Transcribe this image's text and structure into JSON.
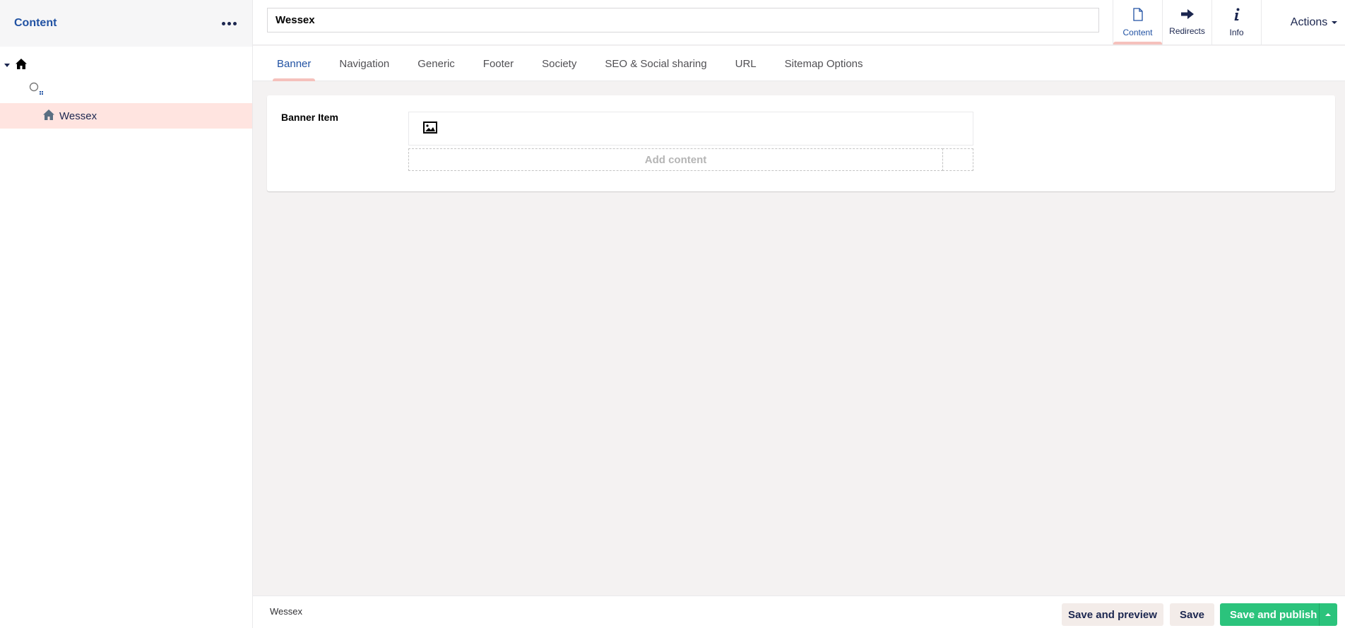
{
  "sidebar": {
    "title": "Content",
    "menu_icon": "ellipsis-icon",
    "tree": [
      {
        "label": "",
        "icon": "home-icon",
        "expanded": true
      },
      {
        "label": "",
        "icon": "circle-dots-icon"
      },
      {
        "label": "Wessex",
        "icon": "home-icon",
        "selected": true
      }
    ]
  },
  "header": {
    "node_name": "Wessex",
    "apps": [
      {
        "label": "Content",
        "icon": "document-icon",
        "active": true
      },
      {
        "label": "Redirects",
        "icon": "arrow-right-icon"
      },
      {
        "label": "Info",
        "icon": "info-icon"
      }
    ],
    "actions_label": "Actions"
  },
  "tabs": [
    {
      "label": "Banner",
      "active": true
    },
    {
      "label": "Navigation"
    },
    {
      "label": "Generic"
    },
    {
      "label": "Footer"
    },
    {
      "label": "Society"
    },
    {
      "label": "SEO & Social sharing"
    },
    {
      "label": "URL"
    },
    {
      "label": "Sitemap Options"
    }
  ],
  "content": {
    "field_label": "Banner Item",
    "block_icon": "picture-icon",
    "add_content_label": "Add content"
  },
  "footer": {
    "breadcrumb": "Wessex",
    "save_preview_label": "Save and preview",
    "save_label": "Save",
    "publish_label": "Save and publish"
  },
  "colors": {
    "accent_blue": "#2152a3",
    "text_navy": "#1b264f",
    "selected_row": "#ffe4e0",
    "active_indicator": "#f5c1bc",
    "publish_green": "#2bc37c",
    "background": "#f4f2f2"
  }
}
